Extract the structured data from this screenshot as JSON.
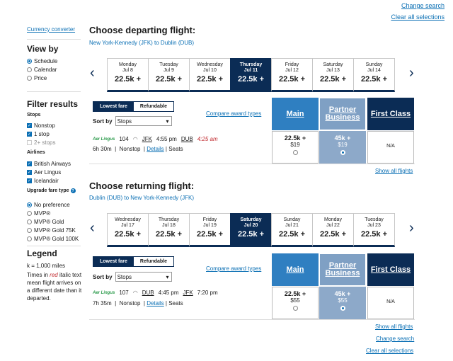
{
  "top": {
    "change_search": "Change search",
    "clear_all": "Clear all selections"
  },
  "sidebar": {
    "currency": "Currency converter",
    "view_by": {
      "title": "View by",
      "options": [
        "Schedule",
        "Calendar",
        "Price"
      ]
    },
    "filter": {
      "title": "Filter results",
      "stops_label": "Stops",
      "stops": [
        "Nonstop",
        "1 stop",
        "2+ stops"
      ],
      "airlines_label": "Airlines",
      "airlines": [
        "British Airways",
        "Aer Lingus",
        "Icelandair"
      ],
      "upgrade_label": "Upgrade fare type",
      "upgrade": [
        "No preference",
        "MVP®",
        "MVP® Gold",
        "MVP® Gold 75K",
        "MVP® Gold 100K"
      ]
    },
    "legend": {
      "title": "Legend",
      "k_def": "k = 1,000 miles",
      "text_pre": "Times in ",
      "text_red": "red",
      "text_post": " italic text mean flight arrives on a different date than it departed."
    }
  },
  "departing": {
    "title": "Choose departing flight:",
    "route": "New York-Kennedy (JFK) to Dublin (DUB)",
    "dates": [
      {
        "dow": "Monday",
        "date": "Jul 8",
        "amt": "22.5k +"
      },
      {
        "dow": "Tuesday",
        "date": "Jul 9",
        "amt": "22.5k +"
      },
      {
        "dow": "Wednesday",
        "date": "Jul 10",
        "amt": "22.5k +"
      },
      {
        "dow": "Thursday",
        "date": "Jul 11",
        "amt": "22.5k +"
      },
      {
        "dow": "Friday",
        "date": "Jul 12",
        "amt": "22.5k +"
      },
      {
        "dow": "Saturday",
        "date": "Jul 13",
        "amt": "22.5k +"
      },
      {
        "dow": "Sunday",
        "date": "Jul 14",
        "amt": "22.5k +"
      }
    ],
    "selected_index": 3,
    "fare_tabs": [
      "Lowest fare",
      "Refundable"
    ],
    "sort_label": "Sort by",
    "sort_value": "Stops",
    "compare": "Compare award types",
    "cabins": [
      "Main",
      "Partner Business",
      "First Class"
    ],
    "flight": {
      "airline": "Aer Lingus",
      "number": "104",
      "from": "JFK",
      "dep": "4:55 pm",
      "to": "DUB",
      "arr": "4:25 am",
      "duration": "6h 30m",
      "stops": "Nonstop",
      "details": "Details",
      "seats": "Seats"
    },
    "fares": [
      {
        "miles": "22.5k +",
        "cash": "$19"
      },
      {
        "miles": "45k +",
        "cash": "$19"
      },
      {
        "na": "N/A"
      }
    ],
    "show_all": "Show all flights"
  },
  "returning": {
    "title": "Choose returning flight:",
    "route": "Dublin (DUB) to New York-Kennedy (JFK)",
    "dates": [
      {
        "dow": "Wednesday",
        "date": "Jul 17",
        "amt": "22.5k +"
      },
      {
        "dow": "Thursday",
        "date": "Jul 18",
        "amt": "22.5k +"
      },
      {
        "dow": "Friday",
        "date": "Jul 19",
        "amt": "22.5k +"
      },
      {
        "dow": "Saturday",
        "date": "Jul 20",
        "amt": "22.5k +"
      },
      {
        "dow": "Sunday",
        "date": "Jul 21",
        "amt": "22.5k +"
      },
      {
        "dow": "Monday",
        "date": "Jul 22",
        "amt": "22.5k +"
      },
      {
        "dow": "Tuesday",
        "date": "Jul 23",
        "amt": "22.5k +"
      }
    ],
    "selected_index": 3,
    "fare_tabs": [
      "Lowest fare",
      "Refundable"
    ],
    "sort_label": "Sort by",
    "sort_value": "Stops",
    "compare": "Compare award types",
    "cabins": [
      "Main",
      "Partner Business",
      "First Class"
    ],
    "flight": {
      "airline": "Aer Lingus",
      "number": "107",
      "from": "DUB",
      "dep": "4:45 pm",
      "to": "JFK",
      "arr": "7:20 pm",
      "duration": "7h 35m",
      "stops": "Nonstop",
      "details": "Details",
      "seats": "Seats"
    },
    "fares": [
      {
        "miles": "22.5k +",
        "cash": "$55"
      },
      {
        "miles": "45k +",
        "cash": "$55"
      },
      {
        "na": "N/A"
      }
    ],
    "show_all": "Show all flights"
  },
  "bottom": {
    "change_search": "Change search",
    "clear_all": "Clear all selections"
  },
  "colors": {
    "navy": "#0b2c55",
    "main_blue": "#2f7fc1",
    "partner_blue": "#7fa0c4",
    "link": "#0a6fb4"
  },
  "icons": {
    "prev": "chevron-left-icon",
    "next": "chevron-right-icon",
    "wifi": "wifi-icon"
  }
}
